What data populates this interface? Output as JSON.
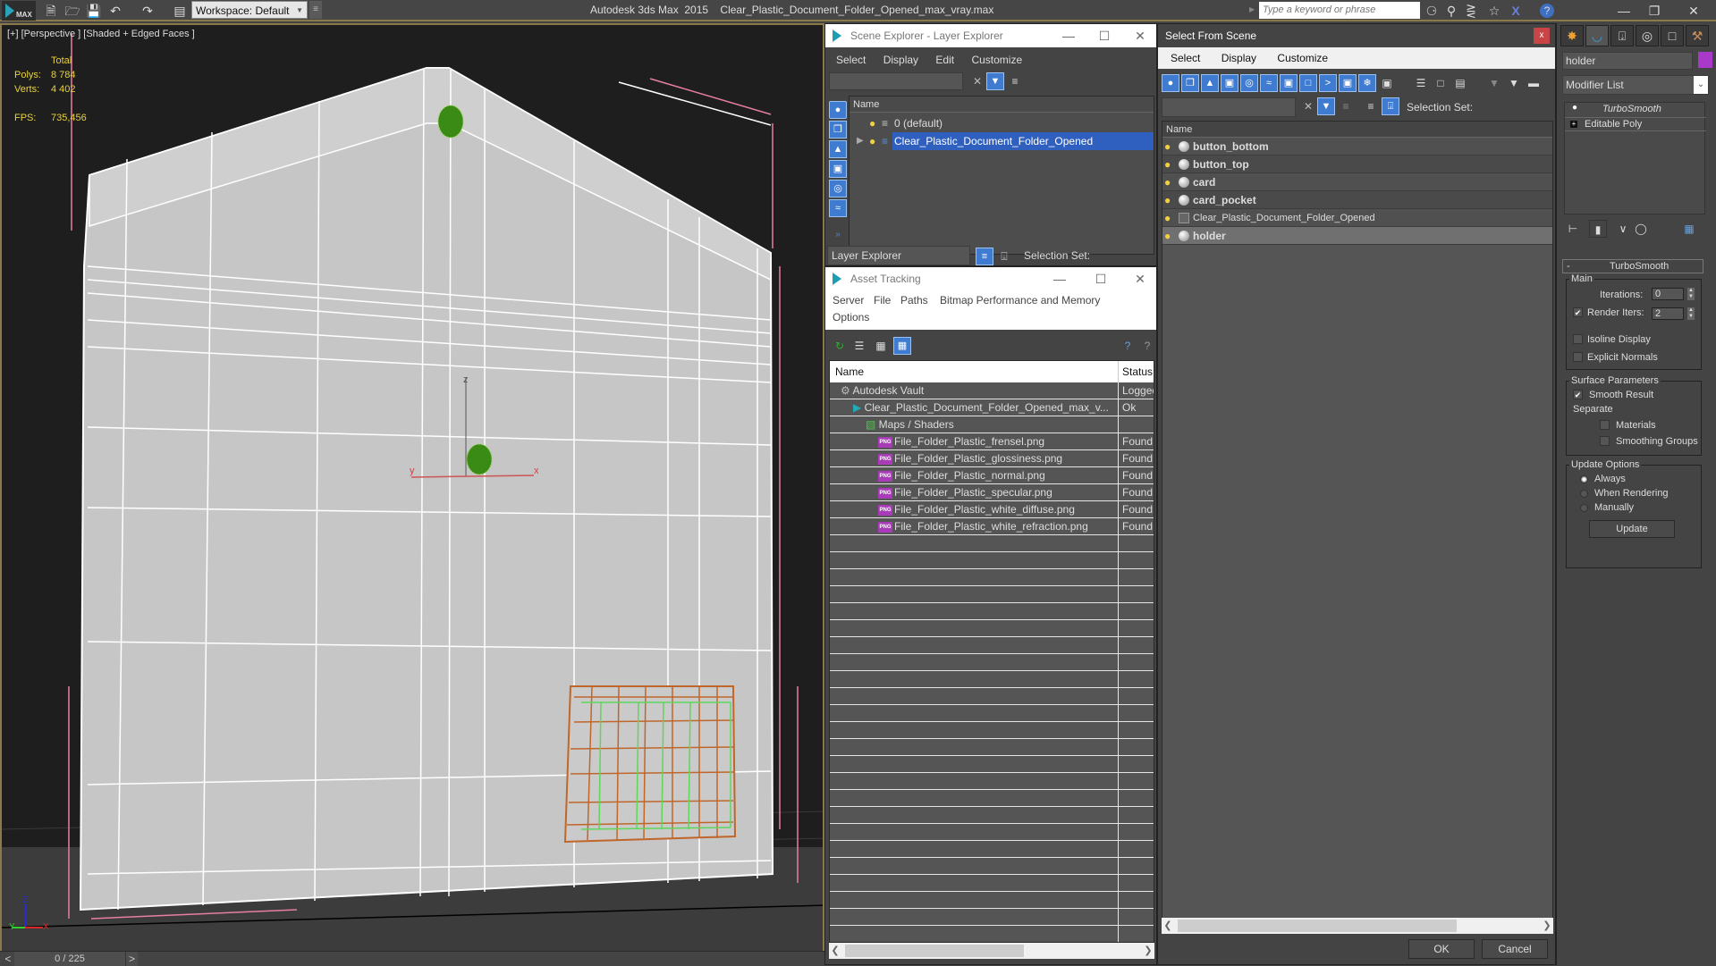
{
  "app": {
    "title": "Autodesk 3ds Max  2015    Clear_Plastic_Document_Folder_Opened_max_vray.max",
    "logo_text": "MAX",
    "workspace": "Workspace: Default",
    "search_placeholder": "Type a keyword or phrase",
    "quick_access_icons": [
      "new-file-icon",
      "open-file-icon",
      "save-icon",
      "undo-icon",
      "redo-icon",
      "project-folder-icon"
    ],
    "info_icons": [
      "binoculars-icon",
      "key-icon",
      "satellite-icon",
      "star-icon",
      "exchange-icon",
      "help-icon"
    ],
    "window_controls": [
      "minimize",
      "restore",
      "close"
    ]
  },
  "viewport": {
    "label": "[+] [Perspective ] [Shaded + Edged Faces ]",
    "stats": {
      "total_label": "Total",
      "polys_label": "Polys:",
      "polys_value": "8 784",
      "verts_label": "Verts:",
      "verts_value": "4 402",
      "fps_label": "FPS:",
      "fps_value": "735,456"
    },
    "gizmo_labels": {
      "z": "z",
      "x": "x",
      "y": "y"
    },
    "axis_labels": {
      "z": "Z",
      "x": "X",
      "y": "Y"
    }
  },
  "timeline": {
    "frame": "0 / 225",
    "prev": "<",
    "next": ">"
  },
  "scene_explorer": {
    "title": "Scene Explorer - Layer Explorer",
    "menus": [
      "Select",
      "Display",
      "Edit",
      "Customize"
    ],
    "column": "Name",
    "layers": [
      {
        "name": "0 (default)",
        "selected": false,
        "expandable": false
      },
      {
        "name": "Clear_Plastic_Document_Folder_Opened",
        "selected": true,
        "expandable": true
      }
    ],
    "footer_dropdown": "Layer Explorer",
    "selection_set_label": "Selection Set:"
  },
  "asset_tracking": {
    "title": "Asset Tracking",
    "menus": [
      "Server",
      "File",
      "Paths",
      "Bitmap Performance and Memory",
      "Options"
    ],
    "columns": [
      "Name",
      "Status"
    ],
    "rows": [
      {
        "name": "Autodesk Vault",
        "status": "Logged",
        "indent": 1,
        "icon": "vault-icon"
      },
      {
        "name": "Clear_Plastic_Document_Folder_Opened_max_v...",
        "status": "Ok",
        "indent": 2,
        "icon": "max-file-icon"
      },
      {
        "name": "Maps / Shaders",
        "status": "",
        "indent": 3,
        "icon": "maps-icon"
      },
      {
        "name": "File_Folder_Plastic_frensel.png",
        "status": "Found",
        "indent": 4,
        "icon": "png-icon"
      },
      {
        "name": "File_Folder_Plastic_glossiness.png",
        "status": "Found",
        "indent": 4,
        "icon": "png-icon"
      },
      {
        "name": "File_Folder_Plastic_normal.png",
        "status": "Found",
        "indent": 4,
        "icon": "png-icon"
      },
      {
        "name": "File_Folder_Plastic_specular.png",
        "status": "Found",
        "indent": 4,
        "icon": "png-icon"
      },
      {
        "name": "File_Folder_Plastic_white_diffuse.png",
        "status": "Found",
        "indent": 4,
        "icon": "png-icon"
      },
      {
        "name": "File_Folder_Plastic_white_refraction.png",
        "status": "Found",
        "indent": 4,
        "icon": "png-icon"
      }
    ],
    "png_badge": "PNG"
  },
  "select_from_scene": {
    "title": "Select From Scene",
    "close": "x",
    "menus": [
      "Select",
      "Display",
      "Customize"
    ],
    "column": "Name",
    "selection_set_label": "Selection Set:",
    "objects": [
      {
        "name": "button_bottom",
        "bold": true,
        "selected": false
      },
      {
        "name": "button_top",
        "bold": true,
        "selected": false
      },
      {
        "name": "card",
        "bold": true,
        "selected": false
      },
      {
        "name": "card_pocket",
        "bold": true,
        "selected": false
      },
      {
        "name": "Clear_Plastic_Document_Folder_Opened",
        "bold": false,
        "selected": false
      },
      {
        "name": "holder",
        "bold": true,
        "selected": true
      }
    ],
    "ok": "OK",
    "cancel": "Cancel"
  },
  "command_panel": {
    "object_name": "holder",
    "object_color": "#a93ac9",
    "modifier_list": "Modifier List",
    "stack": [
      {
        "name": "TurboSmooth",
        "italic": true
      },
      {
        "name": "Editable Poly",
        "italic": false
      }
    ],
    "rollout": {
      "title": "TurboSmooth",
      "collapse": "-",
      "main_label": "Main",
      "iterations_label": "Iterations:",
      "iterations_value": "0",
      "render_iters_label": "Render Iters:",
      "render_iters_value": "2",
      "render_iters_checked": true,
      "isoline_label": "Isoline Display",
      "isoline_checked": false,
      "explicit_normals_label": "Explicit Normals",
      "explicit_normals_checked": false,
      "surface_label": "Surface Parameters",
      "smooth_result_label": "Smooth Result",
      "smooth_result_checked": true,
      "separate_label": "Separate",
      "materials_label": "Materials",
      "materials_checked": false,
      "smoothing_groups_label": "Smoothing Groups",
      "smoothing_groups_checked": false,
      "update_label": "Update Options",
      "update_options": [
        "Always",
        "When Rendering",
        "Manually"
      ],
      "update_selected": "Always",
      "update_button": "Update"
    }
  },
  "colors": {
    "selection_blue": "#2f5fbf",
    "viewport_border": "#8a7a4a",
    "stat_yellow": "#e8d23a",
    "png_purple": "#a93ab8"
  }
}
